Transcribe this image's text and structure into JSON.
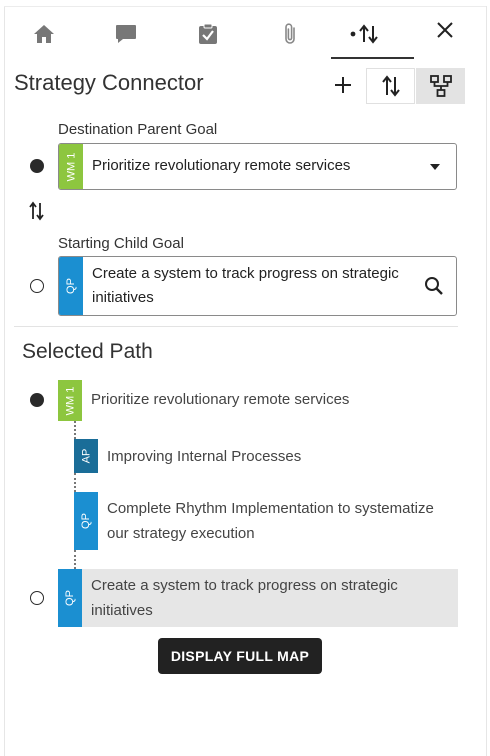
{
  "tabs": [
    {
      "name": "home-icon"
    },
    {
      "name": "comment-icon"
    },
    {
      "name": "clipboard-check-icon"
    },
    {
      "name": "paperclip-icon"
    },
    {
      "name": "strategy-connector-icon",
      "active": true
    }
  ],
  "header": {
    "title": "Strategy Connector"
  },
  "form": {
    "destination_label": "Destination Parent Goal",
    "destination": {
      "tag": "WM 1",
      "text": "Prioritize revolutionary remote services"
    },
    "starting_label": "Starting Child Goal",
    "starting": {
      "tag": "QP",
      "line1": "Create a system to track progress on strategic",
      "line2": "initiatives"
    }
  },
  "selected_path": {
    "title": "Selected Path",
    "items": [
      {
        "tag": "WM 1",
        "text": "Prioritize revolutionary remote services"
      },
      {
        "tag": "AP",
        "text": "Improving Internal Processes"
      },
      {
        "tag": "QP",
        "line1": "Complete Rhythm Implementation to systematize",
        "line2": "our strategy execution"
      },
      {
        "tag": "QP",
        "line1": "Create a system to track progress on strategic",
        "line2": "initiatives"
      }
    ]
  },
  "actions": {
    "display_full_map": "DISPLAY FULL MAP"
  },
  "colors": {
    "wm_green": "#8dc63f",
    "qp_blue": "#1b8fd1",
    "ap_blue": "#1a6d98",
    "button_dark": "#222222"
  }
}
